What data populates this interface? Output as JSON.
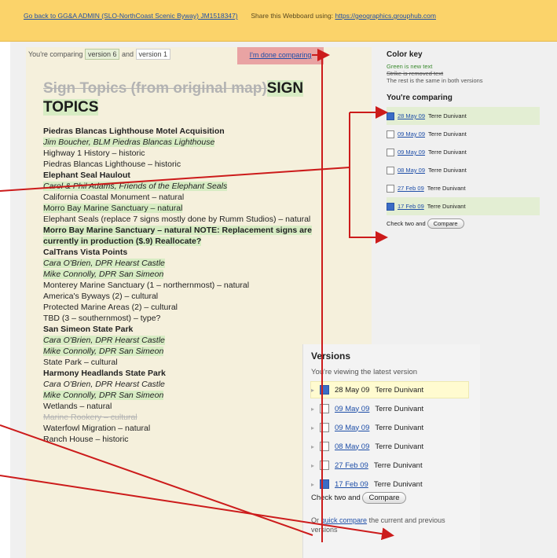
{
  "banner": {
    "back_link": "Go back to GG&A ADMIN (SLO-NorthCoast Scenic Byway) JM1518347)",
    "share_text": "Share this Webboard using:",
    "share_link": "https://geographics.grouphub.com"
  },
  "compare_bar": {
    "prefix": "You're comparing",
    "version_a": "version 6",
    "and": "and",
    "version_b": "version 1",
    "done_link": "I'm done comparing"
  },
  "page_title": {
    "old": "Sign Topics (from original map)",
    "new": "SIGN TOPICS"
  },
  "sections": [
    {
      "heading": "Piedras Blancas Lighthouse Motel Acquisition",
      "lines": [
        {
          "text": "Jim Boucher, BLM Piedras Blancas Lighthouse",
          "style": "ins-it"
        },
        {
          "text": "Highway 1 History – historic",
          "style": "plain"
        },
        {
          "text": "Piedras Blancas Lighthouse – historic",
          "style": "plain"
        }
      ]
    },
    {
      "heading": "Elephant Seal Haulout",
      "lines": [
        {
          "text": "Carol & Phil Adams, Friends of the Elephant Seals",
          "style": "ins-it"
        },
        {
          "text": "California Coastal Monument – natural",
          "style": "plain"
        },
        {
          "text": "Morro Bay Marine Sanctuary – natural",
          "style": "ins"
        },
        {
          "text": "Elephant Seals (replace 7 signs mostly done by Rumm Studios) – natural",
          "style": "plain"
        },
        {
          "text": "Morro Bay Marine Sanctuary – natural NOTE: Replacement signs are currently in production ($.9) Reallocate?",
          "style": "mixed"
        }
      ]
    },
    {
      "heading": "CalTrans Vista Points",
      "lines": [
        {
          "text": "Cara O'Brien, DPR Hearst Castle",
          "style": "ins-it"
        },
        {
          "text": "Mike Connolly, DPR San Simeon",
          "style": "ins-it"
        },
        {
          "text": "Monterey Marine Sanctuary (1 – northernmost) – natural",
          "style": "plain"
        },
        {
          "text": "America's Byways (2) – cultural",
          "style": "plain"
        },
        {
          "text": "Protected Marine Areas (2) – cultural",
          "style": "plain"
        },
        {
          "text": "TBD (3 – southernmost) – type?",
          "style": "plain"
        }
      ]
    },
    {
      "heading": "San Simeon State Park",
      "lines": [
        {
          "text": "Cara O'Brien, DPR Hearst Castle",
          "style": "ins-it"
        },
        {
          "text": "Mike Connolly, DPR San Simeon",
          "style": "ins-it"
        },
        {
          "text": "State Park – cultural",
          "style": "plain"
        }
      ]
    },
    {
      "heading": "Harmony Headlands State Park",
      "lines": [
        {
          "text": "Cara O'Brien, DPR Hearst Castle",
          "style": "it"
        },
        {
          "text": "Mike Connolly, DPR San Simeon",
          "style": "ins-it"
        },
        {
          "text": "Wetlands – natural",
          "style": "plain"
        },
        {
          "text": "Marine Rookery – cultural",
          "style": "del"
        },
        {
          "text": "Waterfowl Migration – natural",
          "style": "plain"
        },
        {
          "text": "Ranch House – historic",
          "style": "plain"
        }
      ]
    }
  ],
  "color_key": {
    "title": "Color key",
    "green_line": "Green is new text",
    "strike_line": "Strike is removed text",
    "rest_line": "The rest is the same in both versions"
  },
  "comparing_panel": {
    "title": "You're comparing",
    "versions": [
      {
        "date": "28 May 09",
        "author": "Terre Dunivant",
        "checked": true
      },
      {
        "date": "09 May 09",
        "author": "Terre Dunivant",
        "checked": false
      },
      {
        "date": "09 May 09",
        "author": "Terre Dunivant",
        "checked": false
      },
      {
        "date": "08 May 09",
        "author": "Terre Dunivant",
        "checked": false
      },
      {
        "date": "27 Feb 09",
        "author": "Terre Dunivant",
        "checked": false
      },
      {
        "date": "17 Feb 09",
        "author": "Terre Dunivant",
        "checked": true
      }
    ],
    "check_two": "Check two and",
    "compare_btn": "Compare"
  },
  "versions_panel": {
    "title": "Versions",
    "subtitle": "You're viewing the latest version",
    "versions": [
      {
        "date": "28 May 09",
        "author": "Terre Dunivant",
        "checked": true
      },
      {
        "date": "09 May 09",
        "author": "Terre Dunivant",
        "checked": false
      },
      {
        "date": "09 May 09",
        "author": "Terre Dunivant",
        "checked": false
      },
      {
        "date": "08 May 09",
        "author": "Terre Dunivant",
        "checked": false
      },
      {
        "date": "27 Feb 09",
        "author": "Terre Dunivant",
        "checked": false
      },
      {
        "date": "17 Feb 09",
        "author": "Terre Dunivant",
        "checked": true
      }
    ],
    "check_two": "Check two and",
    "compare_btn": "Compare",
    "quick_prefix": "Or",
    "quick_link": "quick compare",
    "quick_suffix": "the current and previous versions"
  },
  "colors": {
    "banner": "#fbd36a",
    "inserted": "#d7ecc3",
    "annotation_arrow": "#cc1b1b",
    "done_button": "#e9a3a3"
  }
}
